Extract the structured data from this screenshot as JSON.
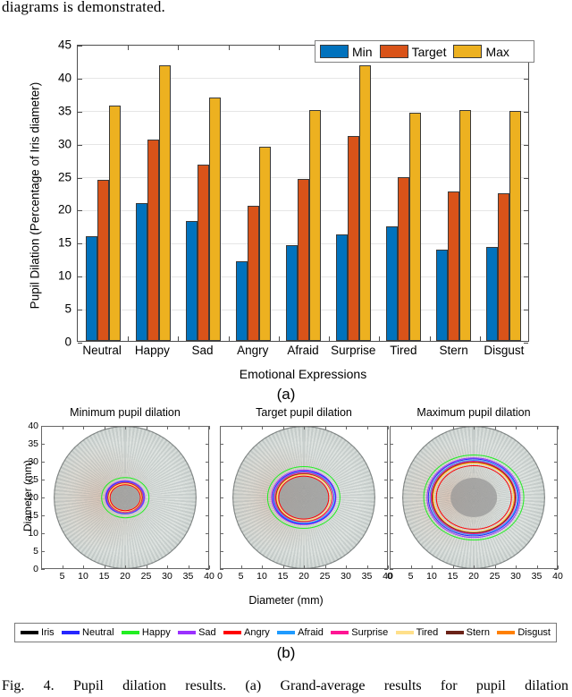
{
  "document": {
    "top_text": "diagrams is demonstrated.",
    "caption": "Fig. 4. Pupil dilation results. (a) Grand-average results for pupil dilation"
  },
  "panel_a": {
    "tag": "(a)",
    "legend": [
      {
        "label": "Min",
        "color": "#0072BD"
      },
      {
        "label": "Target",
        "color": "#D95319"
      },
      {
        "label": "Max",
        "color": "#EDB120"
      }
    ]
  },
  "panel_b": {
    "tag": "(b)",
    "xlabel": "Diameter (mm)",
    "ylabel": "Diameter (mm)",
    "subplot_titles": [
      "Minimum pupil dilation",
      "Target pupil dilation",
      "Maximum pupil dilation"
    ],
    "axis_ticks_x": [
      "0",
      "5",
      "10",
      "15",
      "20",
      "25",
      "30",
      "35",
      "40"
    ],
    "axis_ticks_y": [
      "0",
      "5",
      "10",
      "15",
      "20",
      "25",
      "30",
      "35",
      "40"
    ],
    "legend": [
      {
        "label": "Iris",
        "color": "#000000"
      },
      {
        "label": "Neutral",
        "color": "#2626FF"
      },
      {
        "label": "Happy",
        "color": "#22EE22"
      },
      {
        "label": "Sad",
        "color": "#9B30FF"
      },
      {
        "label": "Angry",
        "color": "#FF0000"
      },
      {
        "label": "Afraid",
        "color": "#1E9BFF"
      },
      {
        "label": "Surprise",
        "color": "#FF1493"
      },
      {
        "label": "Tired",
        "color": "#FFE08A"
      },
      {
        "label": "Stern",
        "color": "#6B2318"
      },
      {
        "label": "Disgust",
        "color": "#FF8000"
      }
    ],
    "subplot_rings": [
      {
        "panel": "Minimum pupil dilation",
        "pupil_core_mm": 7.0,
        "rings_mm": [
          {
            "name": "Iris",
            "d": 40.0,
            "color": "#000000"
          },
          {
            "name": "Happy",
            "d": 11.4,
            "color": "#22EE22"
          },
          {
            "name": "Sad",
            "d": 9.6,
            "color": "#9B30FF"
          },
          {
            "name": "Neutral",
            "d": 9.2,
            "color": "#2626FF"
          },
          {
            "name": "Afraid",
            "d": 8.9,
            "color": "#1E9BFF"
          },
          {
            "name": "Surprise",
            "d": 8.7,
            "color": "#FF1493"
          },
          {
            "name": "Stern",
            "d": 8.3,
            "color": "#6B2318"
          },
          {
            "name": "Disgust",
            "d": 8.1,
            "color": "#FF8000"
          },
          {
            "name": "Tired",
            "d": 7.9,
            "color": "#FFE08A"
          },
          {
            "name": "Angry",
            "d": 7.4,
            "color": "#FF0000"
          }
        ]
      },
      {
        "panel": "Target pupil dilation",
        "pupil_core_mm": 12.0,
        "rings_mm": [
          {
            "name": "Iris",
            "d": 40.0,
            "color": "#000000"
          },
          {
            "name": "Happy",
            "d": 17.5,
            "color": "#22EE22"
          },
          {
            "name": "Sad",
            "d": 15.6,
            "color": "#9B30FF"
          },
          {
            "name": "Neutral",
            "d": 15.0,
            "color": "#2626FF"
          },
          {
            "name": "Afraid",
            "d": 14.4,
            "color": "#1E9BFF"
          },
          {
            "name": "Surprise",
            "d": 14.1,
            "color": "#FF1493"
          },
          {
            "name": "Stern",
            "d": 13.5,
            "color": "#6B2318"
          },
          {
            "name": "Disgust",
            "d": 13.2,
            "color": "#FF8000"
          },
          {
            "name": "Tired",
            "d": 12.9,
            "color": "#FFE08A"
          },
          {
            "name": "Angry",
            "d": 12.2,
            "color": "#FF0000"
          }
        ]
      },
      {
        "panel": "Maximum pupil dilation",
        "pupil_core_mm": 11.0,
        "rings_mm": [
          {
            "name": "Iris",
            "d": 40.0,
            "color": "#000000"
          },
          {
            "name": "Happy",
            "d": 24.0,
            "color": "#22EE22"
          },
          {
            "name": "Sad",
            "d": 22.4,
            "color": "#9B30FF"
          },
          {
            "name": "Neutral",
            "d": 21.8,
            "color": "#2626FF"
          },
          {
            "name": "Afraid",
            "d": 21.0,
            "color": "#1E9BFF"
          },
          {
            "name": "Surprise",
            "d": 20.5,
            "color": "#FF1493"
          },
          {
            "name": "Stern",
            "d": 20.0,
            "color": "#6B2318"
          },
          {
            "name": "Disgust",
            "d": 19.6,
            "color": "#FF8000"
          },
          {
            "name": "Tired",
            "d": 19.2,
            "color": "#FFE08A"
          },
          {
            "name": "Angry",
            "d": 18.0,
            "color": "#FF0000"
          }
        ]
      }
    ]
  },
  "chart_data": [
    {
      "type": "bar",
      "title": "",
      "xlabel": "Emotional Expressions",
      "ylabel": "Pupil Dilation (Percentage of Iris diameter)",
      "categories": [
        "Neutral",
        "Happy",
        "Sad",
        "Angry",
        "Afraid",
        "Surprise",
        "Tired",
        "Stern",
        "Disgust"
      ],
      "series": [
        {
          "name": "Min",
          "color": "#0072BD",
          "values": [
            15.9,
            20.9,
            18.2,
            12.0,
            14.5,
            16.1,
            17.4,
            13.8,
            14.3
          ]
        },
        {
          "name": "Target",
          "color": "#D95319",
          "values": [
            24.4,
            30.5,
            26.7,
            20.5,
            24.6,
            31.1,
            24.8,
            22.7,
            22.3
          ]
        },
        {
          "name": "Max",
          "color": "#EDB120",
          "values": [
            35.6,
            41.7,
            36.9,
            29.4,
            35.0,
            41.8,
            34.5,
            35.0,
            34.8
          ]
        }
      ],
      "ylim": [
        0,
        45
      ],
      "yticks": [
        0,
        5,
        10,
        15,
        20,
        25,
        30,
        35,
        40,
        45
      ],
      "grid": true,
      "legend_position": "top-right"
    },
    {
      "type": "scatter",
      "title": "Minimum pupil dilation",
      "xlabel": "Diameter (mm)",
      "ylabel": "Diameter (mm)",
      "xlim": [
        0,
        40
      ],
      "ylim": [
        0,
        40
      ],
      "description": "Iris image with concentric pupil-boundary circles per emotion"
    },
    {
      "type": "scatter",
      "title": "Target pupil dilation",
      "xlabel": "Diameter (mm)",
      "ylabel": "Diameter (mm)",
      "xlim": [
        0,
        40
      ],
      "ylim": [
        0,
        40
      ],
      "description": "Iris image with concentric pupil-boundary circles per emotion"
    },
    {
      "type": "scatter",
      "title": "Maximum pupil dilation",
      "xlabel": "Diameter (mm)",
      "ylabel": "Diameter (mm)",
      "xlim": [
        0,
        40
      ],
      "ylim": [
        0,
        40
      ],
      "description": "Iris image with concentric pupil-boundary circles per emotion"
    }
  ]
}
